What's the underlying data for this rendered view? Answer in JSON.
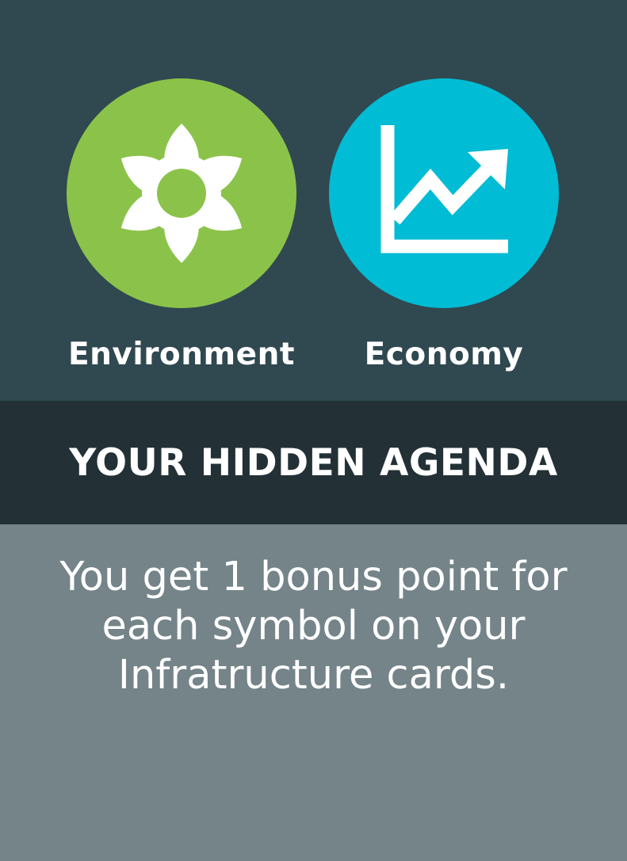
{
  "symbols": [
    {
      "label": "Environment",
      "icon": "flower-icon",
      "color": "#8bc34a"
    },
    {
      "label": "Economy",
      "icon": "trend-chart-icon",
      "color": "#00bcd4"
    }
  ],
  "agenda": {
    "title": "YOUR HIDDEN AGENDA",
    "description": "You get 1 bonus point for each symbol on your Infratructure cards."
  },
  "colors": {
    "top_background": "#304850",
    "band_background": "#233137",
    "bottom_background": "#748489",
    "text": "#ffffff"
  }
}
